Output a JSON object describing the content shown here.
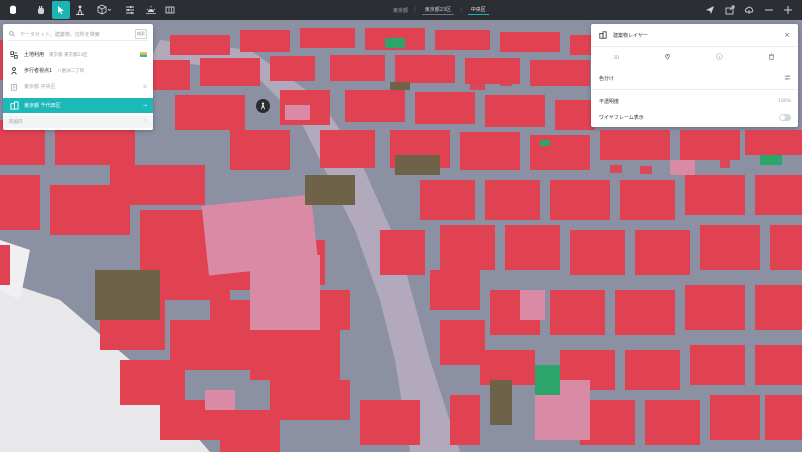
{
  "topbar": {
    "breadcrumbs": [
      "東京都",
      "東京都23区",
      "中央区"
    ],
    "tools": [
      "app-logo-icon",
      "grab-icon",
      "select-icon",
      "pedestrian-icon",
      "cube-icon",
      "sliders-icon",
      "sun-icon",
      "map-icon"
    ],
    "right_tools": [
      "send-icon",
      "export-icon",
      "cloud-icon",
      "minus-icon",
      "plus-icon"
    ]
  },
  "layer_panel": {
    "search_placeholder": "データセット、建築物、住所を検索",
    "search_button": "検索",
    "layers": [
      {
        "label": "土地利用",
        "sub": "東京都 東京都23区",
        "icon": "land-use-icon"
      },
      {
        "label": "歩行者視点1",
        "sub": "八重洲二丁目",
        "icon": "pedestrian-icon"
      },
      {
        "label": "東京都 中央区",
        "sub": "",
        "icon": "building-icon"
      },
      {
        "label": "東京都 千代田区",
        "sub": "",
        "icon": "building-stack-icon"
      }
    ],
    "footer_label": "四国内"
  },
  "building_panel": {
    "title": "建築物レイヤー",
    "tabs": [
      "2D",
      "場所",
      "情報",
      "削除"
    ],
    "color_label": "色分け",
    "opacity_label": "不透明度",
    "opacity_value": "100%",
    "wireframe_label": "ワイヤフレーム表示"
  },
  "colors": {
    "accent": "#1bb5b3",
    "building_red": "#e04252",
    "building_pink": "#d98aa4",
    "building_olive": "#6e6248",
    "building_green": "#2ca56a",
    "road": "#8b90a3",
    "river": "#b2a9bc"
  }
}
